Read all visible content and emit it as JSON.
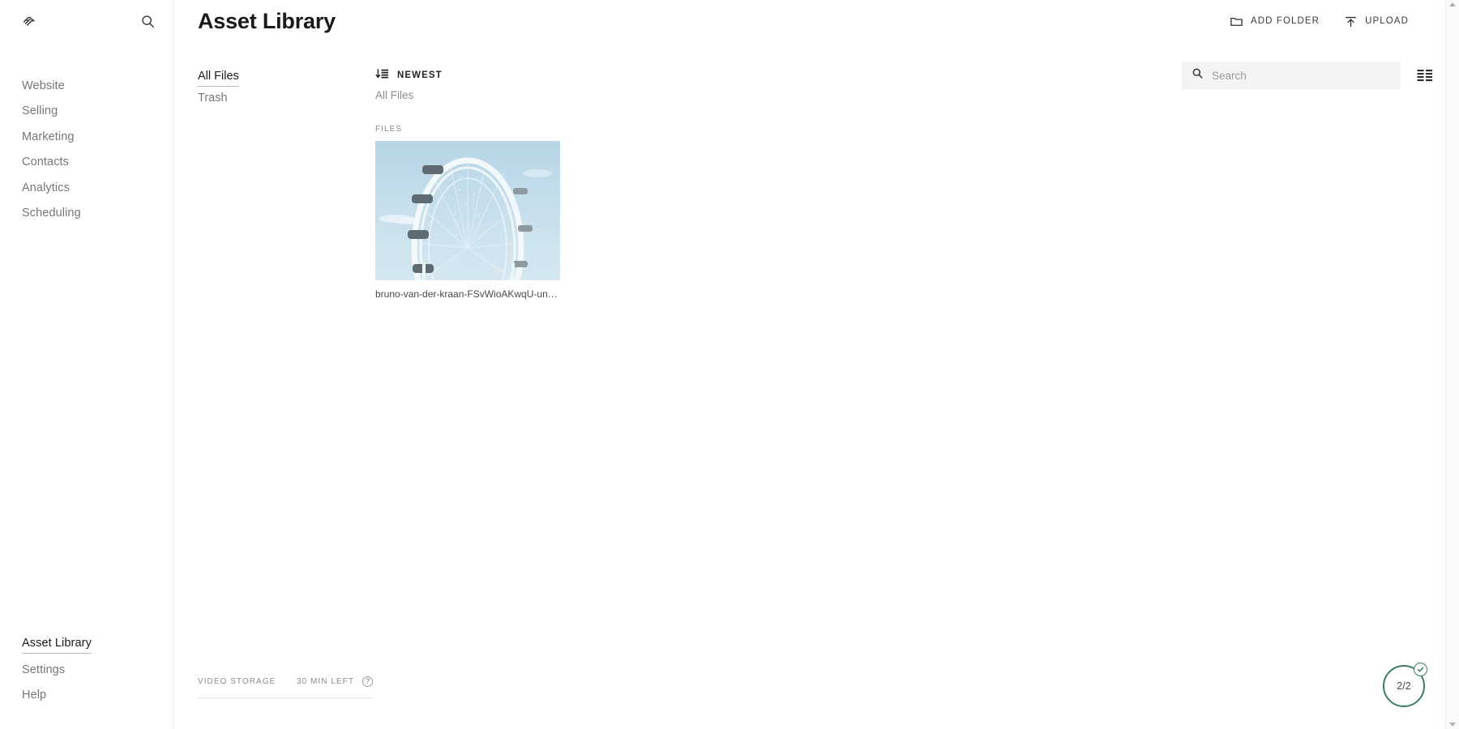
{
  "sidebar": {
    "logo_icon": "squarespace-logo-icon",
    "search_icon": "search-icon",
    "nav": [
      {
        "label": "Website"
      },
      {
        "label": "Selling"
      },
      {
        "label": "Marketing"
      },
      {
        "label": "Contacts"
      },
      {
        "label": "Analytics"
      },
      {
        "label": "Scheduling"
      }
    ],
    "bottom_nav": [
      {
        "label": "Asset Library",
        "active": true
      },
      {
        "label": "Settings",
        "active": false
      },
      {
        "label": "Help",
        "active": false
      }
    ]
  },
  "header": {
    "title": "Asset Library",
    "add_folder_label": "ADD FOLDER",
    "add_folder_icon": "folder-icon",
    "upload_label": "UPLOAD",
    "upload_icon": "upload-arrow-icon"
  },
  "folders": {
    "items": [
      {
        "label": "All Files",
        "active": true
      },
      {
        "label": "Trash",
        "active": false
      }
    ],
    "storage": {
      "label": "VIDEO STORAGE",
      "value": "30 MIN LEFT",
      "help_icon": "question-mark-icon",
      "help_glyph": "?",
      "bar_percent": 0
    }
  },
  "toolbar": {
    "sort_label": "NEWEST",
    "sort_icon": "sort-descending-icon",
    "search_placeholder": "Search",
    "search_value": "",
    "search_icon": "search-icon",
    "view_toggle_icon": "list-view-icon"
  },
  "breadcrumb": {
    "path": "All Files"
  },
  "files": {
    "section_label": "FILES",
    "items": [
      {
        "name": "bruno-van-der-kraan-FSvWioAKwqU-unsplas...",
        "thumbnail": "ferris-wheel-photo"
      }
    ]
  },
  "upload_status": {
    "count": "2/2",
    "check_icon": "check-icon",
    "accent_color": "#3c7d62"
  },
  "scrollbar": {
    "up_icon": "chevron-up-icon",
    "down_icon": "chevron-down-icon"
  }
}
